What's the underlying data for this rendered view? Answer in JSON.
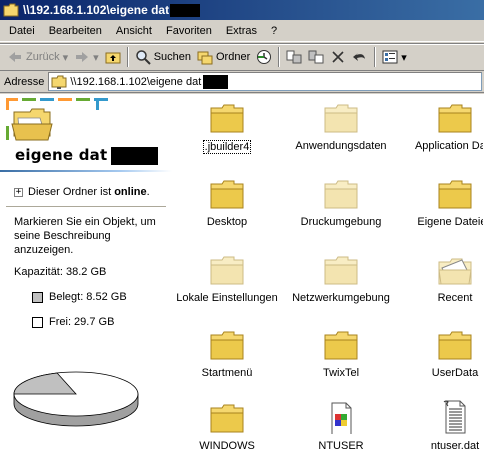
{
  "window": {
    "title": "\\\\192.168.1.102\\eigene dat"
  },
  "menu": [
    "Datei",
    "Bearbeiten",
    "Ansicht",
    "Favoriten",
    "Extras",
    "?"
  ],
  "toolbar": {
    "back_label": "Zurück",
    "search_label": "Suchen",
    "folders_label": "Ordner"
  },
  "address": {
    "label": "Adresse",
    "value": "\\\\192.168.1.102\\eigene dat"
  },
  "left_panel": {
    "title": "eigene dat",
    "online_prefix": "Dieser Ordner ist ",
    "online_status": "online",
    "online_suffix": ".",
    "description": "Markieren Sie ein Objekt, um seine Beschreibung anzuzeigen.",
    "capacity": "Kapazität: 38.2 GB",
    "used": "Belegt: 8.52 GB",
    "free": "Frei: 29.7 GB",
    "used_color": "#c0c0c0",
    "free_color": "#ffffff",
    "used_fraction": 0.223
  },
  "items": [
    {
      "label": ".jbuilder4",
      "icon": "folder-icon"
    },
    {
      "label": "Anwendungsdaten",
      "icon": "folder-hidden-icon"
    },
    {
      "label": "Application Data",
      "icon": "folder-icon"
    },
    {
      "label": "Desktop",
      "icon": "folder-icon"
    },
    {
      "label": "Druckumgebung",
      "icon": "folder-hidden-icon"
    },
    {
      "label": "Eigene Dateien",
      "icon": "folder-icon"
    },
    {
      "label": "Lokale Einstellungen",
      "icon": "folder-hidden-icon"
    },
    {
      "label": "Netzwerkumgebung",
      "icon": "folder-hidden-icon"
    },
    {
      "label": "Recent",
      "icon": "recent-folder-icon"
    },
    {
      "label": "Startmenü",
      "icon": "folder-icon"
    },
    {
      "label": "TwixTel",
      "icon": "folder-icon"
    },
    {
      "label": "UserData",
      "icon": "folder-icon"
    },
    {
      "label": "WINDOWS",
      "icon": "folder-icon"
    },
    {
      "label": "NTUSER",
      "icon": "ntuser-file-icon"
    },
    {
      "label": "ntuser.dat",
      "icon": "dat-file-icon"
    }
  ]
}
